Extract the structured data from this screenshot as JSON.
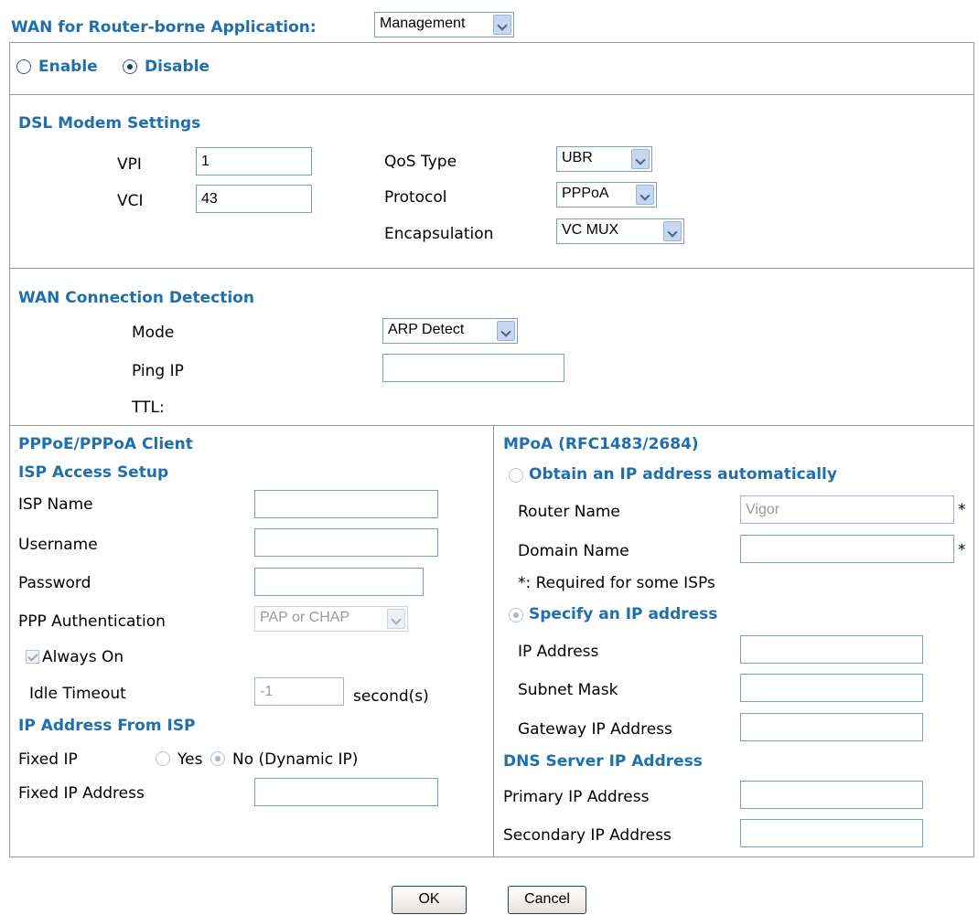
{
  "wan_app": {
    "label": "WAN for Router-borne Application:",
    "value": "Management"
  },
  "state": {
    "enable": "Enable",
    "disable": "Disable",
    "selected": "Disable"
  },
  "dsl": {
    "title": "DSL Modem Settings",
    "vpi_label": "VPI",
    "vpi": "1",
    "vci_label": "VCI",
    "vci": "43",
    "qos_label": "QoS Type",
    "qos": "UBR",
    "protocol_label": "Protocol",
    "protocol": "PPPoA",
    "encap_label": "Encapsulation",
    "encap": "VC MUX"
  },
  "detect": {
    "title": "WAN Connection Detection",
    "mode_label": "Mode",
    "mode": "ARP Detect",
    "ping_label": "Ping IP",
    "ping": "",
    "ttl_label": "TTL:"
  },
  "ppp": {
    "title": "PPPoE/PPPoA Client",
    "isp_title": "ISP Access Setup",
    "isp_name_label": "ISP Name",
    "isp_name": "",
    "username_label": "Username",
    "username": "",
    "password_label": "Password",
    "password": "",
    "auth_label": "PPP Authentication",
    "auth": "PAP or CHAP",
    "always_on": "Always On",
    "idle_label": "Idle Timeout",
    "idle": "-1",
    "idle_unit": "second(s)",
    "ipisp_title": "IP Address From ISP",
    "fixed_label": "Fixed IP",
    "yes": "Yes",
    "no": "No (Dynamic IP)",
    "fixed_addr_label": "Fixed IP Address",
    "fixed_addr": ""
  },
  "mpoa": {
    "title": "MPoA (RFC1483/2684)",
    "obtain": "Obtain an IP address automatically",
    "router_label": "Router Name",
    "router": "Vigor",
    "domain_label": "Domain Name",
    "domain": "",
    "asterisk": "*",
    "required_note": "*: Required for some ISPs",
    "specify": "Specify an IP address",
    "ip_label": "IP Address",
    "ip": "",
    "mask_label": "Subnet Mask",
    "mask": "",
    "gw_label": "Gateway IP Address",
    "gw": "",
    "dns_title": "DNS Server IP Address",
    "primary_label": "Primary IP Address",
    "primary": "",
    "secondary_label": "Secondary IP Address",
    "secondary": ""
  },
  "buttons": {
    "ok": "OK",
    "cancel": "Cancel"
  }
}
